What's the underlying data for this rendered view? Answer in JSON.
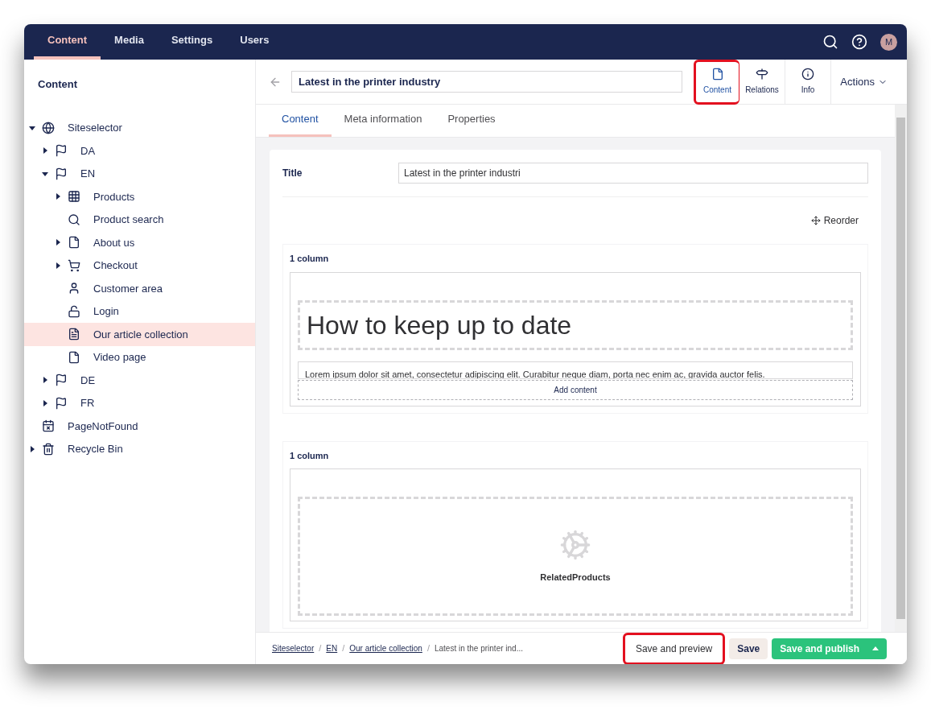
{
  "top_nav": {
    "tabs": [
      {
        "label": "Content",
        "selected": true
      },
      {
        "label": "Media",
        "selected": false
      },
      {
        "label": "Settings",
        "selected": false
      },
      {
        "label": "Users",
        "selected": false
      }
    ],
    "avatar": "M"
  },
  "sidebar": {
    "title": "Content",
    "tree": [
      {
        "label": "Siteselector",
        "kind": "globe",
        "expanded": true,
        "selected": false,
        "children": [
          {
            "label": "DA",
            "kind": "flag",
            "expanded": false,
            "selected": false
          },
          {
            "label": "EN",
            "kind": "flag",
            "expanded": true,
            "selected": false,
            "children": [
              {
                "label": "Products",
                "kind": "grid",
                "expanded": false,
                "selected": false
              },
              {
                "label": "Product search",
                "kind": "search",
                "selected": false
              },
              {
                "label": "About us",
                "kind": "page",
                "expanded": false,
                "selected": false
              },
              {
                "label": "Checkout",
                "kind": "cart",
                "expanded": false,
                "selected": false
              },
              {
                "label": "Customer area",
                "kind": "user",
                "selected": false
              },
              {
                "label": "Login",
                "kind": "unlock",
                "selected": false
              },
              {
                "label": "Our article collection",
                "kind": "article",
                "selected": true
              },
              {
                "label": "Video page",
                "kind": "page",
                "selected": false
              }
            ]
          },
          {
            "label": "DE",
            "kind": "flag",
            "expanded": false,
            "selected": false
          },
          {
            "label": "FR",
            "kind": "flag",
            "expanded": false,
            "selected": false
          }
        ]
      },
      {
        "label": "PageNotFound",
        "kind": "error-page",
        "selected": false
      },
      {
        "label": "Recycle Bin",
        "kind": "trash",
        "expanded": false,
        "selected": false
      }
    ]
  },
  "editor": {
    "page_name": "Latest in the printer industry",
    "views": [
      {
        "label": "Content",
        "kind": "page",
        "selected": true,
        "highlighted": true
      },
      {
        "label": "Relations",
        "kind": "signpost",
        "selected": false,
        "highlighted": false
      },
      {
        "label": "Info",
        "kind": "info",
        "selected": false,
        "highlighted": false
      }
    ],
    "actions": "Actions",
    "tabs": [
      {
        "label": "Content",
        "selected": true
      },
      {
        "label": "Meta information",
        "selected": false
      },
      {
        "label": "Properties",
        "selected": false
      }
    ],
    "title_label": "Title",
    "title_value": "Latest in the printer industri",
    "reorder": "Reorder",
    "rows": [
      {
        "label": "1 column",
        "kind": "text",
        "heading": "How to keep up to date",
        "body": "Lorem ipsum dolor sit amet, consectetur adipiscing elit. Curabitur neque diam, porta nec enim ac, gravida auctor felis.",
        "add": "Add content"
      },
      {
        "label": "1 column",
        "kind": "app",
        "app_name": "RelatedProducts"
      }
    ]
  },
  "footer": {
    "separator": "/",
    "breadcrumbs": [
      {
        "label": "Siteselector",
        "link": true
      },
      {
        "label": "EN",
        "link": true
      },
      {
        "label": "Our article collection",
        "link": true
      },
      {
        "label": "Latest in the printer ind...",
        "link": false
      }
    ],
    "buttons": [
      {
        "label": "Save and preview",
        "kind": "plain",
        "highlighted": true
      },
      {
        "label": "Save",
        "kind": "secondary",
        "highlighted": false
      },
      {
        "label": "Save and publish",
        "kind": "primary",
        "highlighted": false
      }
    ]
  }
}
